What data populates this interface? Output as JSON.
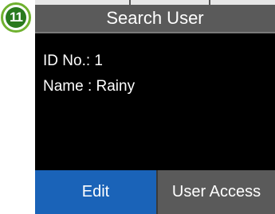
{
  "step_badge": {
    "number": "11"
  },
  "header": {
    "title": "Search User"
  },
  "user": {
    "id_line": "ID No.: 1",
    "name_line": "Name : Rainy"
  },
  "buttons": {
    "edit": "Edit",
    "user_access": "User Access"
  },
  "colors": {
    "title_bar": "#5a5a5a",
    "screen_background": "#000000",
    "active_button": "#1a63b8",
    "inactive_button": "#5a5a5a",
    "badge_ring": "#6fb12f",
    "badge_fill": "#2a7a1e"
  }
}
